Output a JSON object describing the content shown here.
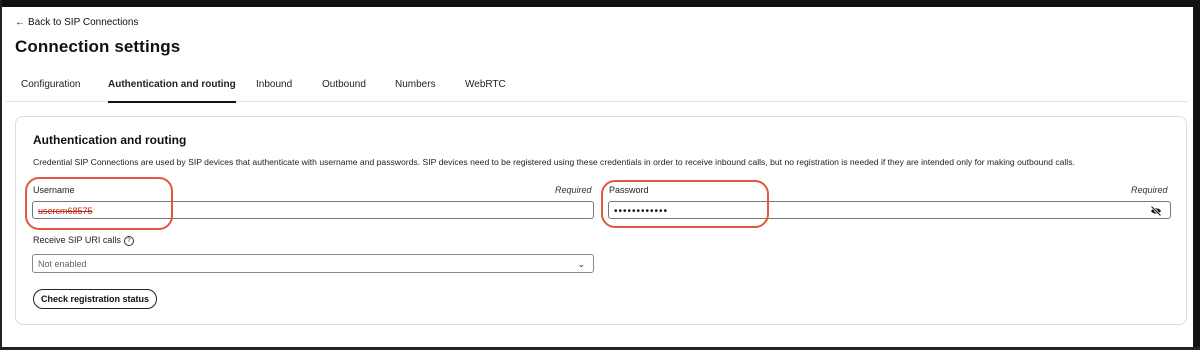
{
  "nav": {
    "back_label": "Back to SIP Connections"
  },
  "page": {
    "title": "Connection settings"
  },
  "tabs": [
    {
      "label": "Configuration",
      "active": false
    },
    {
      "label": "Authentication and routing",
      "active": true
    },
    {
      "label": "Inbound",
      "active": false
    },
    {
      "label": "Outbound",
      "active": false
    },
    {
      "label": "Numbers",
      "active": false
    },
    {
      "label": "WebRTC",
      "active": false
    }
  ],
  "section": {
    "title": "Authentication and routing",
    "description": "Credential SIP Connections are used by SIP devices that authenticate with username and passwords. SIP devices need to be registered using these credentials in order to receive inbound calls, but no registration is needed if they are intended only for making outbound calls."
  },
  "username": {
    "label": "Username",
    "required_label": "Required",
    "value": "usercm68575"
  },
  "password": {
    "label": "Password",
    "required_label": "Required",
    "masked_value": "••••••••••••",
    "visibility_icon": "eye-off-icon"
  },
  "sip_uri": {
    "label": "Receive SIP URI calls",
    "help_icon": "question-circle-icon",
    "selected": "Not enabled"
  },
  "check_button": {
    "label": "Check registration status"
  },
  "colors": {
    "highlight": "#e2583e",
    "active_tab": "#111111",
    "username_value": "#c02818"
  }
}
